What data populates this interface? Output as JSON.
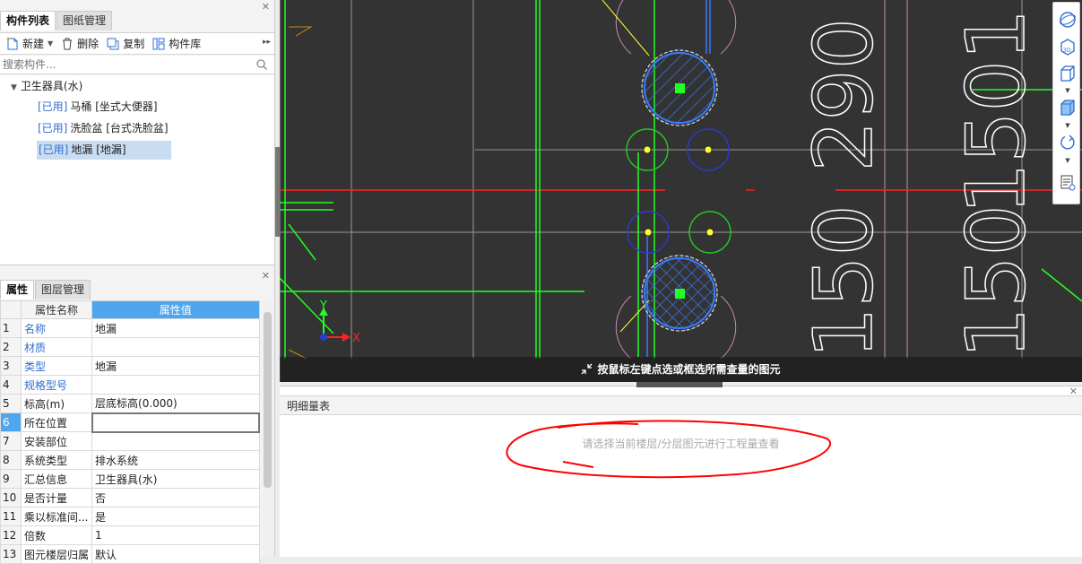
{
  "component_panel": {
    "tabs": [
      {
        "label": "构件列表",
        "active": true
      },
      {
        "label": "图纸管理",
        "active": false
      }
    ],
    "toolbar": {
      "new_label": "新建",
      "delete_label": "删除",
      "copy_label": "复制",
      "library_label": "构件库"
    },
    "search_placeholder": "搜索构件...",
    "tree": {
      "root": "卫生器具(水)",
      "items": [
        {
          "tag": "[已用]",
          "label": "马桶 [坐式大便器]"
        },
        {
          "tag": "[已用]",
          "label": "洗脸盆 [台式洗脸盆]"
        },
        {
          "tag": "[已用]",
          "label": "地漏 [地漏]",
          "selected": true
        }
      ]
    }
  },
  "properties_panel": {
    "tabs": [
      {
        "label": "属性",
        "active": true
      },
      {
        "label": "图层管理",
        "active": false
      }
    ],
    "header_name": "属性名称",
    "header_value": "属性值",
    "rows": [
      {
        "idx": "1",
        "name": "名称",
        "value": "地漏",
        "blue": true
      },
      {
        "idx": "2",
        "name": "材质",
        "value": "",
        "blue": true
      },
      {
        "idx": "3",
        "name": "类型",
        "value": "地漏",
        "blue": true
      },
      {
        "idx": "4",
        "name": "规格型号",
        "value": "",
        "blue": true
      },
      {
        "idx": "5",
        "name": "标高(m)",
        "value": "层底标高(0.000)",
        "blue": false
      },
      {
        "idx": "6",
        "name": "所在位置",
        "value": "",
        "blue": false,
        "current": true
      },
      {
        "idx": "7",
        "name": "安装部位",
        "value": "",
        "blue": false
      },
      {
        "idx": "8",
        "name": "系统类型",
        "value": "排水系统",
        "blue": false
      },
      {
        "idx": "9",
        "name": "汇总信息",
        "value": "卫生器具(水)",
        "blue": false
      },
      {
        "idx": "10",
        "name": "是否计量",
        "value": "否",
        "blue": false
      },
      {
        "idx": "11",
        "name": "乘以标准间...",
        "value": "是",
        "blue": false
      },
      {
        "idx": "12",
        "name": "倍数",
        "value": "1",
        "blue": false
      },
      {
        "idx": "13",
        "name": "图元楼层归属",
        "value": "默认",
        "blue": false
      }
    ]
  },
  "canvas": {
    "background": "#333333",
    "hint": "按鼠标左键点选或框选所需查量的图元",
    "axis_x": "X",
    "axis_y": "Y",
    "dimension_texts": [
      "290",
      "1501",
      "150",
      "150"
    ]
  },
  "view_toolbar": {
    "icons": [
      "orbit-icon",
      "cube-3d-icon",
      "cube-icon",
      "cube-solid-icon",
      "rotate-icon",
      "layer-visibility-icon"
    ],
    "cube_3d_label": "3D"
  },
  "detail_panel": {
    "title": "明细量表",
    "message": "请选择当前楼层/分层图元进行工程量查看"
  },
  "colors": {
    "accent": "#4da6ee",
    "tag_blue": "#2f6fd0",
    "selection": "#c8dcf2",
    "cad_green": "#22ff22",
    "cad_red": "#ff2222",
    "cad_blue": "#3a7bff",
    "annotation_red": "#ff0000"
  }
}
